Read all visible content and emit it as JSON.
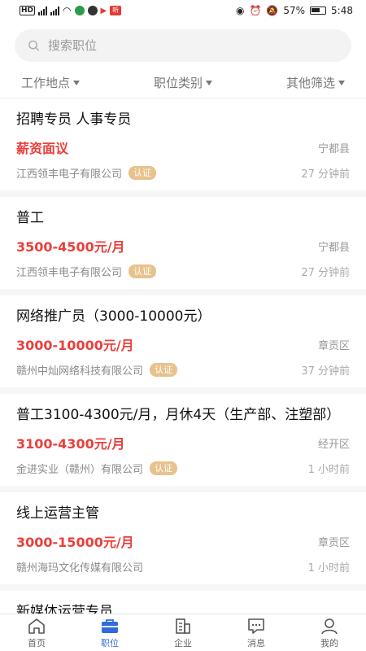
{
  "status_bar": {
    "left_text": "HD",
    "battery": "57%",
    "time": "5:48"
  },
  "search": {
    "placeholder": "搜索职位"
  },
  "filters": [
    {
      "label": "工作地点"
    },
    {
      "label": "职位类别"
    },
    {
      "label": "其他筛选"
    }
  ],
  "jobs": [
    {
      "title": "招聘专员 人事专员",
      "salary": "薪资面议",
      "location": "宁都县",
      "company": "江西领丰电子有限公司",
      "badge": "认证",
      "time": "27 分钟前"
    },
    {
      "title": "普工",
      "salary": "3500-4500元/月",
      "location": "宁都县",
      "company": "江西领丰电子有限公司",
      "badge": "认证",
      "time": "27 分钟前"
    },
    {
      "title": "网络推广员（3000-10000元）",
      "salary": "3000-10000元/月",
      "location": "章贡区",
      "company": "赣州中灿网络科技有限公司",
      "badge": "认证",
      "time": "37 分钟前"
    },
    {
      "title": "普工3100-4300元/月，月休4天（生产部、注塑部）",
      "salary": "3100-4300元/月",
      "location": "经开区",
      "company": "金进实业（赣州）有限公司",
      "badge": "认证",
      "time": "1 小时前"
    },
    {
      "title": "线上运营主管",
      "salary": "3000-15000元/月",
      "location": "章贡区",
      "company": "赣州海玛文化传媒有限公司",
      "badge": "",
      "time": "1 小时前"
    },
    {
      "title": "新媒体运营专员"
    }
  ],
  "tabs": [
    {
      "label": "首页",
      "icon": "home-icon"
    },
    {
      "label": "职位",
      "icon": "briefcase-icon",
      "active": true
    },
    {
      "label": "企业",
      "icon": "building-icon"
    },
    {
      "label": "消息",
      "icon": "message-icon"
    },
    {
      "label": "我的",
      "icon": "user-icon"
    }
  ],
  "colors": {
    "accent": "#2f6bdc",
    "salary": "#e9403c",
    "badge": "#e8c28d"
  }
}
